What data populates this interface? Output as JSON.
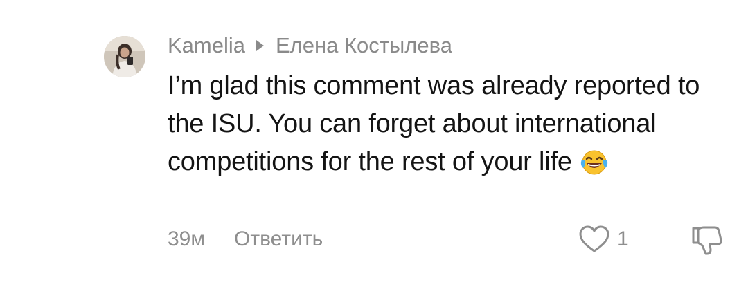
{
  "comment": {
    "author": "Kamelia",
    "reply_to": "Елена Костылева",
    "text": "I’m glad this comment was already reported to the ISU. You can forget about international competitions for the rest of your life",
    "emoji_icon": "face-with-tears-of-joy-icon",
    "time": "39м",
    "reply_label": "Ответить",
    "like_count": "1",
    "like_icon": "heart-outline-icon",
    "dislike_icon": "thumbs-down-outline-icon"
  },
  "colors": {
    "secondary_text": "#8a8a8a",
    "primary_text": "#141414",
    "background": "#ffffff"
  }
}
